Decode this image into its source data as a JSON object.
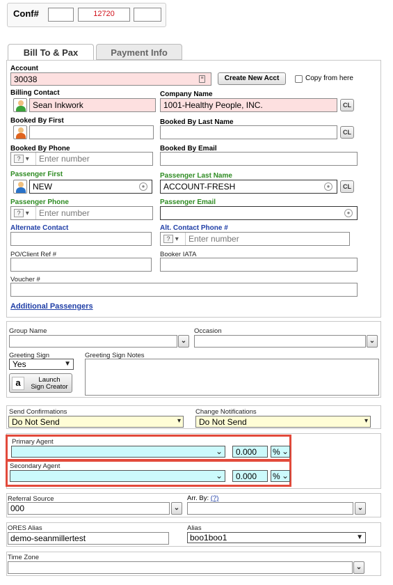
{
  "conf": {
    "label": "Conf#",
    "number": "12720"
  },
  "tabs": [
    {
      "label": "Bill To & Pax",
      "active": true
    },
    {
      "label": "Payment Info",
      "active": false
    }
  ],
  "billto": {
    "account": {
      "label": "Account",
      "value": "30038"
    },
    "create_new_acct": "Create New Acct",
    "copy_from_here": "Copy from here",
    "billing_contact": {
      "label": "Billing Contact",
      "value": "Sean Inkwork"
    },
    "company_name": {
      "label": "Company Name",
      "value": "1001-Healthy People, INC."
    },
    "booked_by_first": {
      "label": "Booked By First",
      "value": ""
    },
    "booked_by_last": {
      "label": "Booked By Last Name",
      "value": ""
    },
    "booked_by_phone": {
      "label": "Booked By Phone",
      "placeholder": "Enter number"
    },
    "booked_by_email": {
      "label": "Booked By Email",
      "value": ""
    },
    "passenger_first": {
      "label": "Passenger First",
      "value": "NEW"
    },
    "passenger_last": {
      "label": "Passenger Last Name",
      "value": "ACCOUNT-FRESH"
    },
    "passenger_phone": {
      "label": "Passenger Phone",
      "placeholder": "Enter number"
    },
    "passenger_email": {
      "label": "Passenger Email",
      "value": ""
    },
    "alternate_contact": {
      "label": "Alternate Contact",
      "value": ""
    },
    "alt_contact_phone": {
      "label": "Alt. Contact Phone #",
      "placeholder": "Enter number"
    },
    "po_ref": {
      "label": "PO/Client Ref #",
      "value": ""
    },
    "booker_iata": {
      "label": "Booker IATA",
      "value": ""
    },
    "voucher": {
      "label": "Voucher #",
      "value": ""
    },
    "additional_passengers": "Additional Passengers",
    "cl": "CL",
    "phone_q": "?"
  },
  "group": {
    "group_name": {
      "label": "Group Name",
      "value": ""
    },
    "occasion": {
      "label": "Occasion",
      "value": ""
    },
    "greeting_sign": {
      "label": "Greeting Sign",
      "value": "Yes"
    },
    "greeting_sign_notes": {
      "label": "Greeting Sign Notes",
      "value": ""
    },
    "launch_sign_creator": {
      "line1": "Launch",
      "line2": "Sign Creator"
    }
  },
  "notifications": {
    "send_confirmations": {
      "label": "Send Confirmations",
      "value": "Do Not Send"
    },
    "change_notifications": {
      "label": "Change Notifications",
      "value": "Do Not Send"
    }
  },
  "agents": {
    "primary": {
      "label": "Primary Agent",
      "value": "",
      "pct": "0.000",
      "unit": "%"
    },
    "secondary": {
      "label": "Secondary Agent",
      "value": "",
      "pct": "0.000",
      "unit": "%"
    },
    "highlight_color": "#e24a3b"
  },
  "referral": {
    "referral_source": {
      "label": "Referral Source",
      "value": "000"
    },
    "arr_by": {
      "label": "Arr. By:",
      "help": "(?)",
      "value": ""
    }
  },
  "alias": {
    "ores_alias": {
      "label": "ORES Alias",
      "value": "demo-seanmillertest"
    },
    "alias": {
      "label": "Alias",
      "value": "boo1boo1"
    }
  },
  "timezone": {
    "label": "Time Zone",
    "value": ""
  },
  "icons": {
    "dropdown": "chevron-down-icon",
    "person": "person-icon",
    "mic": "mic-icon",
    "amazon": "amazon-icon"
  }
}
